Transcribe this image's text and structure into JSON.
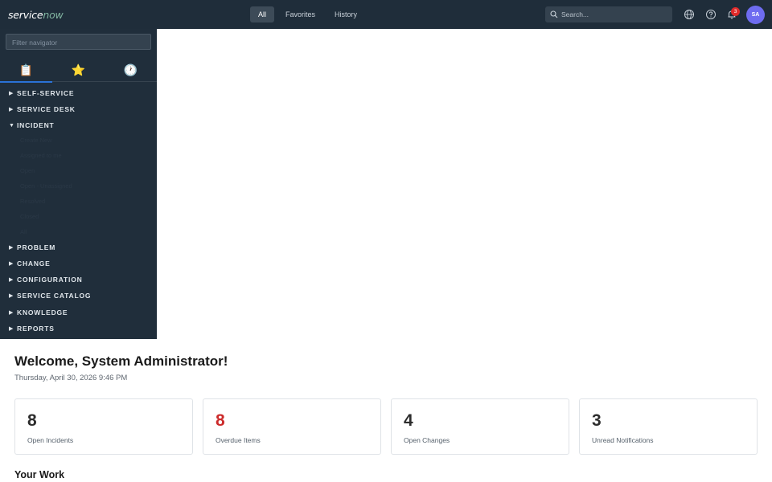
{
  "header": {
    "logo_part1": "service",
    "logo_part2": "now",
    "tabs": [
      {
        "label": "All",
        "active": true
      },
      {
        "label": "Favorites",
        "active": false
      },
      {
        "label": "History",
        "active": false
      }
    ],
    "search_placeholder": "Search...",
    "notification_count": "3",
    "avatar_initials": "SA",
    "icons": [
      "search-icon",
      "globe-icon",
      "help-icon",
      "bell-icon"
    ]
  },
  "navigator": {
    "filter_placeholder": "Filter navigator",
    "tabs": [
      {
        "name": "all-apps",
        "icon": "📋",
        "active": true
      },
      {
        "name": "favorites",
        "icon": "⭐",
        "active": false
      },
      {
        "name": "history",
        "icon": "🕐",
        "active": false
      }
    ],
    "modules": [
      {
        "label": "SELF-SERVICE",
        "expanded": false
      },
      {
        "label": "SERVICE DESK",
        "expanded": false
      },
      {
        "label": "INCIDENT",
        "expanded": true
      },
      {
        "label": "PROBLEM",
        "expanded": false
      },
      {
        "label": "CHANGE",
        "expanded": false
      },
      {
        "label": "CONFIGURATION",
        "expanded": false
      },
      {
        "label": "SERVICE CATALOG",
        "expanded": false
      },
      {
        "label": "KNOWLEDGE",
        "expanded": false
      },
      {
        "label": "REPORTS",
        "expanded": false
      }
    ],
    "incident_items": [
      "Create New",
      "Assigned to me",
      "Open",
      "Open - Unassigned",
      "Resolved",
      "Closed",
      "All"
    ]
  },
  "main": {
    "welcome": "Welcome, System Administrator!",
    "date": "Thursday, April 30, 2026 9:46 PM",
    "cards": [
      {
        "value": "8",
        "label": "Open Incidents",
        "highlight": false
      },
      {
        "value": "8",
        "label": "Overdue Items",
        "highlight": true
      },
      {
        "value": "4",
        "label": "Open Changes",
        "highlight": false
      },
      {
        "value": "3",
        "label": "Unread Notifications",
        "highlight": false
      }
    ],
    "your_work": "Your Work"
  },
  "colors": {
    "header_bg": "#1f2d3a",
    "accent_blue": "#2a72d6",
    "logo_green": "#81b5a1",
    "badge_red": "#e02b2b",
    "avatar": "#6e6cf0",
    "overdue_red": "#cc2b2b"
  }
}
